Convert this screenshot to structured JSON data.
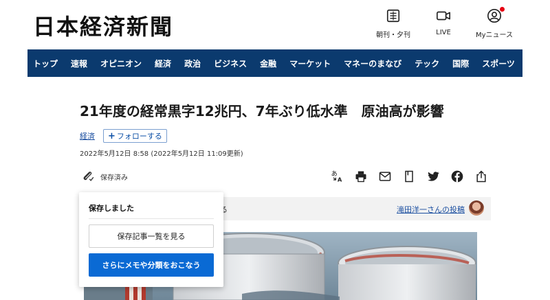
{
  "masthead": {
    "logo": "日本経済新聞",
    "utility": [
      {
        "label": "朝刊・夕刊",
        "icon": "newspaper-icon"
      },
      {
        "label": "LIVE",
        "icon": "video-camera-icon"
      },
      {
        "label": "Myニュース",
        "icon": "user-circle-icon"
      }
    ],
    "notification_color": "#e60012"
  },
  "nav": {
    "color": "#0b3a6e",
    "items": [
      "トップ",
      "速報",
      "オピニオン",
      "経済",
      "政治",
      "ビジネス",
      "金融",
      "マーケット",
      "マネーのまなび",
      "テック",
      "国際",
      "スポーツ"
    ]
  },
  "article": {
    "headline": "21年度の経常黒字12兆円、7年ぶり低水準　原油高が影響",
    "topic": "経済",
    "follow_label": "フォローする",
    "follow_plus": "+",
    "date": "2022年5月12日 8:58 (2022年5月12日 11:09更新)",
    "save_label": "保存済み",
    "share_icons": [
      "text-size-icon",
      "print-icon",
      "mail-icon",
      "bookmark-icon",
      "twitter-icon",
      "facebook-icon",
      "share-icon"
    ]
  },
  "author_strip": {
    "fragment": "る",
    "byline": "滝田洋一さんの投稿"
  },
  "popup": {
    "title": "保存しました",
    "view_button": "保存記事一覧を見る",
    "more_button": "さらにメモや分類をおこなう",
    "accent": "#0a6ad4"
  }
}
